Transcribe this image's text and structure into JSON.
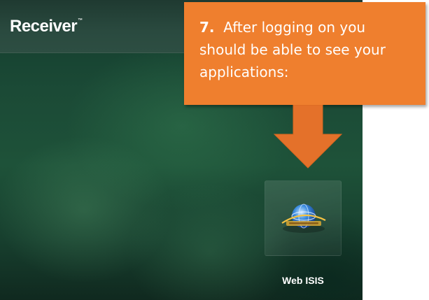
{
  "receiver": {
    "title": "Receiver",
    "trademark": "™"
  },
  "applications": [
    {
      "label": "Web ISIS",
      "icon": "web-isis-globe-icon"
    }
  ],
  "callout": {
    "number": "7.",
    "text": "After logging on you should be able to see your applications:"
  },
  "colors": {
    "callout_orange": "#ef7f2e",
    "arrow_orange": "#e4712a",
    "screen_green": "#1e5239",
    "header_green": "#2a4a3f"
  }
}
